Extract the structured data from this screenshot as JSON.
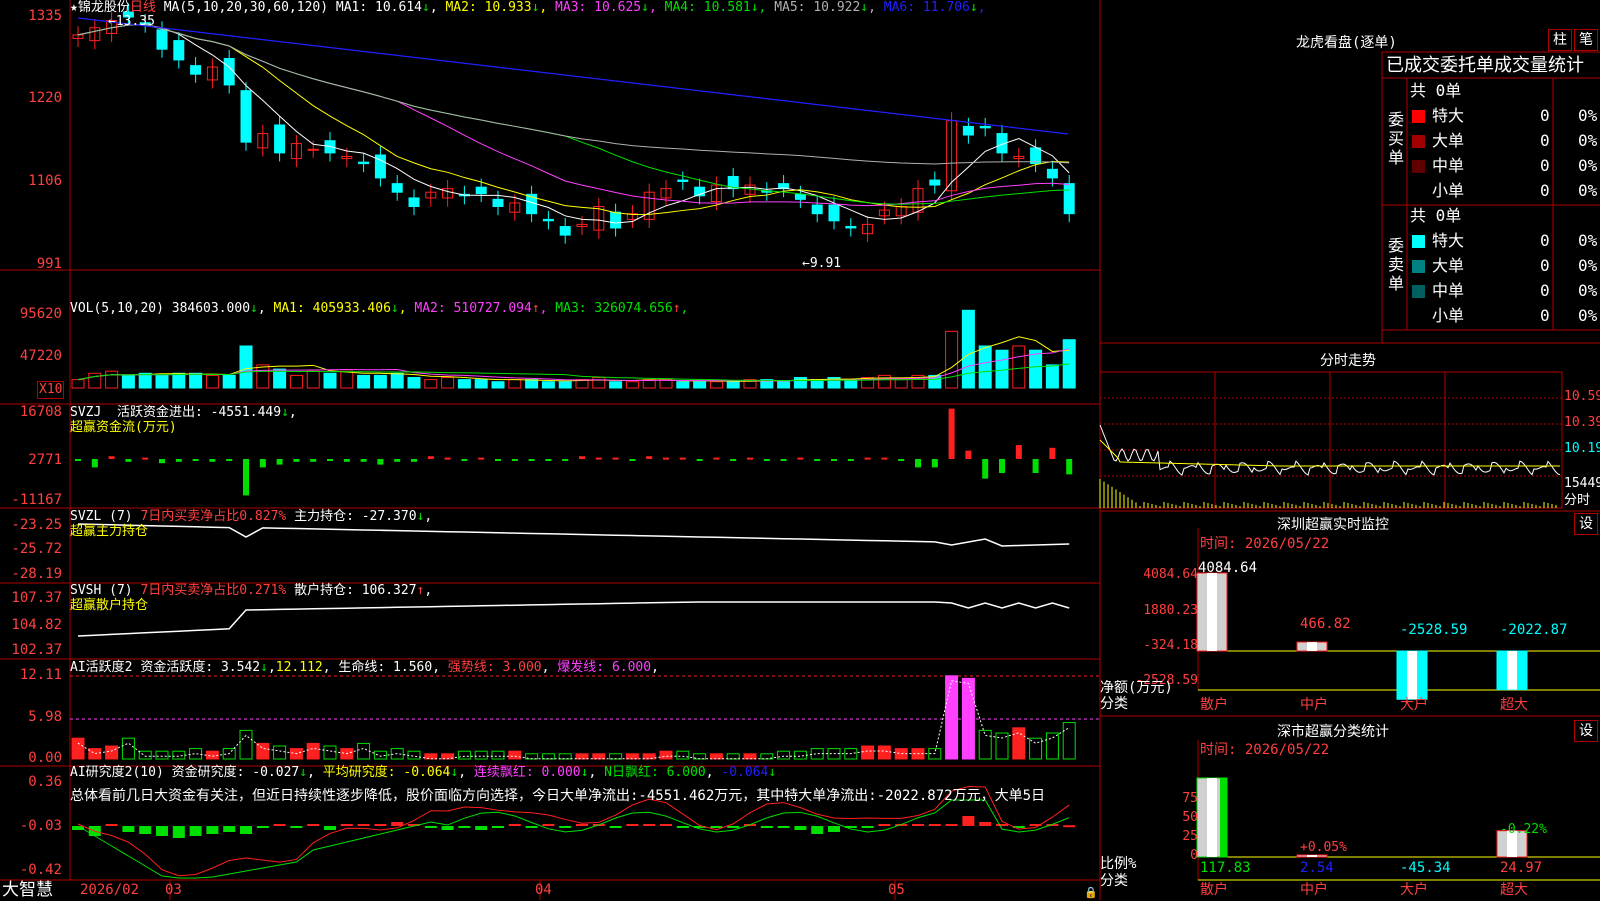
{
  "app": {
    "logo_text": "大智慧"
  },
  "stock": {
    "star": "★",
    "name": "锦龙股份",
    "period": "日线"
  },
  "colors": {
    "red": "#ff2020",
    "cyan": "#00ffff",
    "green": "#00e000",
    "yellow": "#ffff00",
    "magenta": "#ff40ff",
    "white": "#ffffff",
    "blue": "#2020ff",
    "frame": "#b00000",
    "label_red": "#ff4040",
    "gray": "#b0b0b0"
  },
  "price_panel": {
    "ma_title": "MA(5,10,20,30,60,120)",
    "ma": [
      {
        "label": "MA1:",
        "value": "10.614",
        "arrow": "↓",
        "color": "#ffffff"
      },
      {
        "label": "MA2:",
        "value": "10.933",
        "arrow": "↓",
        "color": "#ffff00"
      },
      {
        "label": "MA3:",
        "value": "10.625",
        "arrow": "↓",
        "color": "#ff40ff"
      },
      {
        "label": "MA4:",
        "value": "10.581",
        "arrow": "↓",
        "color": "#00e000"
      },
      {
        "label": "MA5:",
        "value": "10.922",
        "arrow": "↓",
        "color": "#b0b0b0"
      },
      {
        "label": "MA6:",
        "value": "11.706",
        "arrow": "↓",
        "color": "#2020ff"
      }
    ],
    "y_labels": [
      "1335",
      "1220",
      "1106",
      "991"
    ],
    "high_marker": "←13.35",
    "low_marker": "←9.91",
    "x_labels": [
      "2026/02",
      "03",
      "04",
      "05"
    ]
  },
  "vol_panel": {
    "title": "VOL(5,10,20)",
    "value": "384603.000",
    "arrow": "↓",
    "ma": [
      {
        "label": "MA1:",
        "value": "405933.406",
        "arrow": "↓",
        "color": "#ffff00"
      },
      {
        "label": "MA2:",
        "value": "510727.094",
        "arrow": "↑",
        "color": "#ff40ff"
      },
      {
        "label": "MA3:",
        "value": "326074.656",
        "arrow": "↑",
        "color": "#00e000"
      }
    ],
    "y_labels": [
      "95620",
      "47220"
    ],
    "unit": "X10"
  },
  "svzj_panel": {
    "title": "SVZJ",
    "label": "活跃资金进出:",
    "value": "-4551.449",
    "arrow": "↓",
    "subtitle": "超赢资金流(万元)",
    "y_labels": [
      "16708",
      "2771",
      "-11167"
    ]
  },
  "svzl_panel": {
    "title": "SVZL (7)",
    "label1": "7日内买卖净占比",
    "value1": "0.827%",
    "label2": "主力持仓:",
    "value2": "-27.370",
    "arrow": "↓",
    "subtitle": "超赢主力持仓",
    "y_labels": [
      "-23.25",
      "-25.72",
      "-28.19"
    ]
  },
  "svsh_panel": {
    "title": "SVSH (7)",
    "label1": "7日内买卖净占比",
    "value1": "0.271%",
    "label2": "散户持仓:",
    "value2": "106.327",
    "arrow": "↑",
    "subtitle": "超赢散户持仓",
    "y_labels": [
      "107.37",
      "104.82",
      "102.37"
    ]
  },
  "ai_active_panel": {
    "title": "AI活跃度2",
    "label1": "资金活跃度:",
    "value1": "3.542",
    "arrow1": "↓",
    "value2": "12.112",
    "label3": "生命线:",
    "value3": "1.560",
    "label4": "强势线:",
    "value4": "3.000",
    "label5": "爆发线:",
    "value5": "6.000",
    "y_labels": [
      "12.11",
      "5.98",
      "0.00"
    ]
  },
  "ai_research_panel": {
    "title": "AI研究度2(10)",
    "label1": "资金研究度:",
    "value1": "-0.027",
    "arrow1": "↓",
    "label2": "平均研究度:",
    "value2": "-0.064",
    "arrow2": "↓",
    "label3": "连续飘红:",
    "value3": "0.000",
    "arrow3": "↓",
    "label4": "N日飘红:",
    "value4": "6.000",
    "value5": "-0.064",
    "arrow5": "↓",
    "summary": "总体看前几日大资金有关注，但近日持续性逐步降低，股价面临方向选择，今日大单净流出:-4551.462万元，其中特大单净流出:-2022.872万元，大单5日",
    "y_labels": [
      "0.36",
      "-0.03",
      "-0.42"
    ]
  },
  "dragon_panel": {
    "title": "龙虎看盘(逐单)",
    "btn1": "柱",
    "btn2": "笔",
    "subtitle": "已成交委托单成交量统计",
    "buy": {
      "side": "委买单",
      "total": "共 0单",
      "rows": [
        {
          "label": "特大",
          "count": "0",
          "pct": "0%",
          "color": "#ff0000"
        },
        {
          "label": "大单",
          "count": "0",
          "pct": "0%",
          "color": "#a00000"
        },
        {
          "label": "中单",
          "count": "0",
          "pct": "0%",
          "color": "#600000"
        },
        {
          "label": "小单",
          "count": "0",
          "pct": "0%",
          "color": "#000000"
        }
      ]
    },
    "sell": {
      "side": "委卖单",
      "total": "共 0单",
      "rows": [
        {
          "label": "特大",
          "count": "0",
          "pct": "0%",
          "color": "#00ffff"
        },
        {
          "label": "大单",
          "count": "0",
          "pct": "0%",
          "color": "#008080"
        },
        {
          "label": "中单",
          "count": "0",
          "pct": "0%",
          "color": "#006060"
        },
        {
          "label": "小单",
          "count": "0",
          "pct": "0%",
          "color": "#000000"
        }
      ]
    }
  },
  "intraday_panel": {
    "title": "分时走势",
    "y_labels": [
      "10.59",
      "10.39",
      "10.19",
      "15449"
    ],
    "foot": "分时"
  },
  "sz_monitor": {
    "title": "深圳超赢实时监控",
    "settings": "设",
    "time_label": "时间:",
    "time": "2026/05/22",
    "y_labels": [
      "4084.64",
      "1880.23",
      "-324.18",
      "-2528.59"
    ],
    "axis_note1": "净额(万元)",
    "axis_note2": "分类",
    "categories": [
      "散户",
      "中户",
      "大户",
      "超大"
    ],
    "values": [
      4084.64,
      466.82,
      -2528.59,
      -2022.87
    ],
    "value_labels": [
      "4084.64",
      "466.82",
      "-2528.59",
      "-2022.87"
    ]
  },
  "sz_classify": {
    "title": "深市超赢分类统计",
    "settings": "设",
    "time_label": "时间:",
    "time": "2026/05/22",
    "y_labels": [
      "75",
      "50",
      "25",
      "0"
    ],
    "axis_note1": "比例%",
    "axis_note2": "分类",
    "categories": [
      "散户",
      "中户",
      "大户",
      "超大"
    ],
    "values": [
      117.83,
      2.54,
      -45.34,
      24.97
    ],
    "pct_labels": [
      "+0.05%",
      "-0.22%"
    ],
    "bottom_values": [
      "117.83",
      "2.54",
      "-45.34",
      "24.97"
    ]
  }
}
